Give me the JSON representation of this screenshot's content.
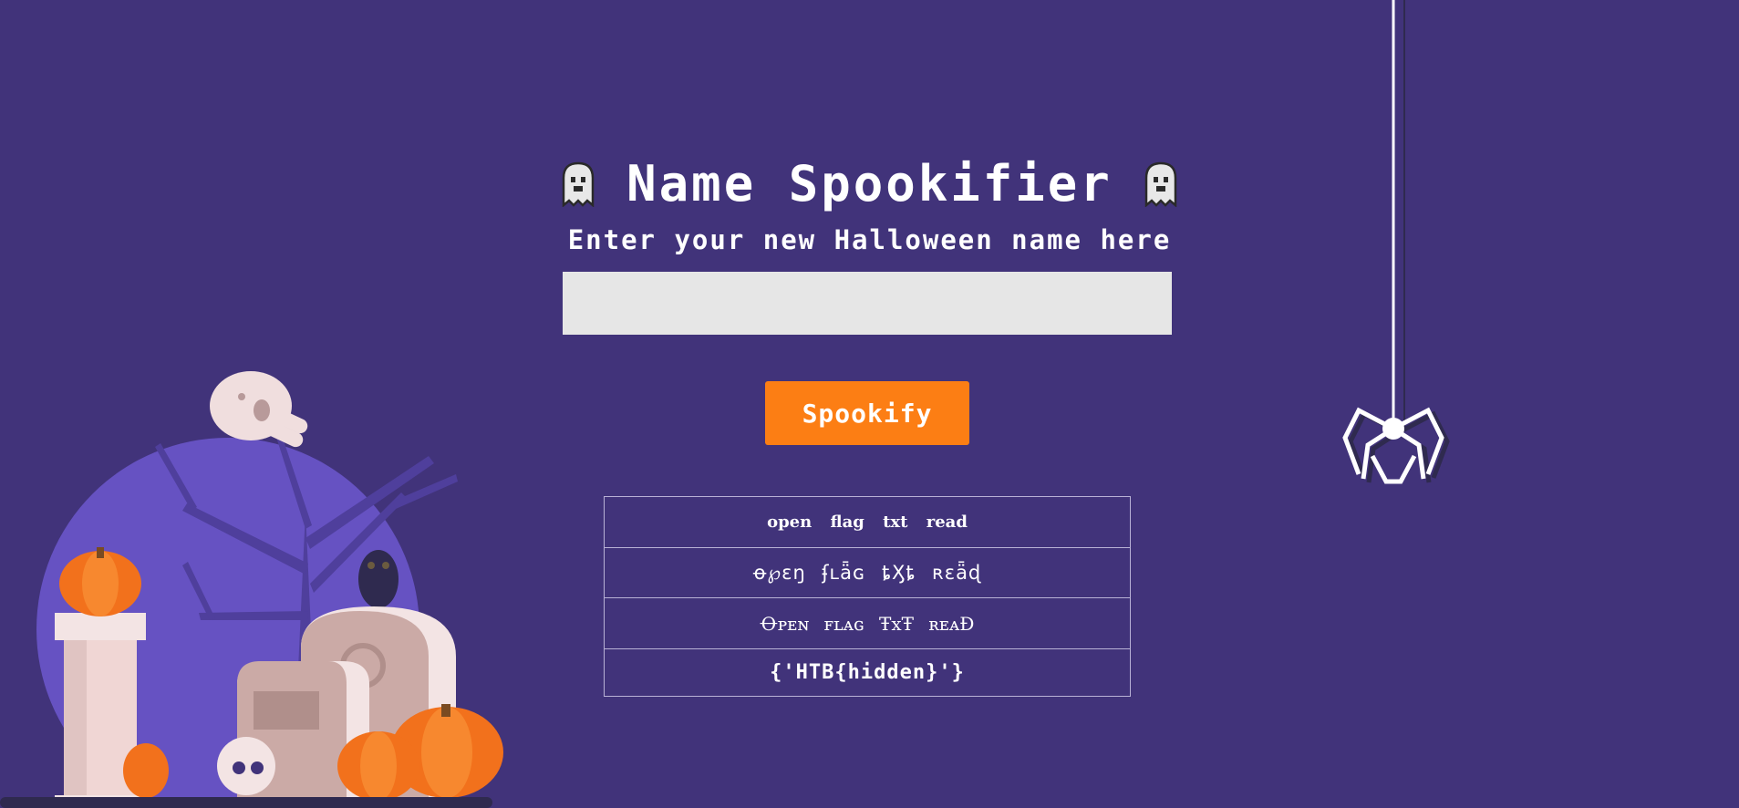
{
  "header": {
    "title": "Name Spookifier",
    "left_icon": "ghost-icon",
    "right_icon": "ghost-icon"
  },
  "form": {
    "prompt": "Enter your new Halloween name here",
    "input_value": "",
    "submit_label": "Spookify"
  },
  "results": [
    "open flag txt read",
    "ꝋ℘ɛŋ ʄʟǟɢ ȶӼȶ ʀɛǟɖ",
    "Ꝋᴘᴇɴ ꜰʟᴀɢ ŦxŦ ʀᴇᴀĐ",
    "{'HTB{hidden}'}"
  ],
  "decor": {
    "scene": "graveyard-illustration",
    "spider": "spider-icon",
    "colors": {
      "background": "#41337a",
      "button": "#fc7e14",
      "input": "#e6e6e6",
      "moon": "#6652c2",
      "pumpkin": "#f2711c"
    }
  }
}
